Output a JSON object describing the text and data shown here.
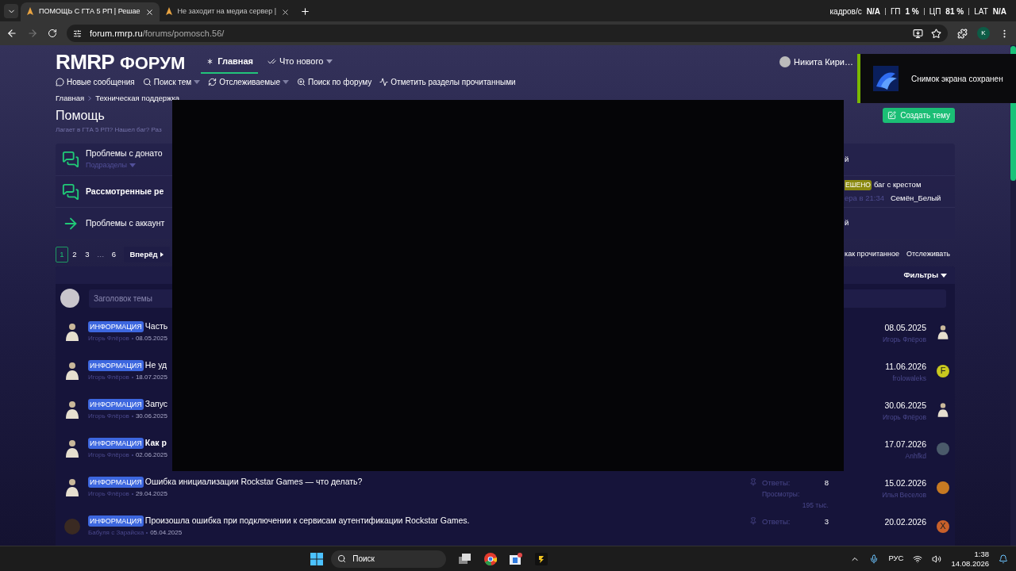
{
  "browser": {
    "tabs": [
      {
        "title": "ПОМОЩЬ С ГТА 5 РП | Решае",
        "selected": true
      },
      {
        "title": "Не заходит на медиа сервер |",
        "selected": false
      }
    ],
    "url_host": "forum.rmrp.ru",
    "url_path": "/forums/pomosch.56/",
    "profile_initial": "K"
  },
  "perf_overlay": [
    {
      "label": "кадров/с",
      "value": "N/A"
    },
    {
      "label": "ГП",
      "value": "1 %"
    },
    {
      "label": "ЦП",
      "value": "81 %"
    },
    {
      "label": "LAT",
      "value": "N/A"
    }
  ],
  "header": {
    "logo": "RMRP",
    "logo_word": "ФОРУМ",
    "nav": [
      {
        "label": "Главная",
        "selected": true,
        "has_menu": false
      },
      {
        "label": "Что нового",
        "selected": false,
        "has_menu": true
      }
    ],
    "user": "Никита Кири…"
  },
  "subnav": [
    {
      "label": "Новые сообщения",
      "kind": "chat",
      "has_menu": false
    },
    {
      "label": "Поиск тем",
      "kind": "search",
      "has_menu": true
    },
    {
      "label": "Отслеживаемые",
      "kind": "refresh",
      "has_menu": true
    },
    {
      "label": "Поиск по форуму",
      "kind": "zoom",
      "has_menu": false
    },
    {
      "label": "Отметить разделы прочитанными",
      "kind": "wave",
      "has_menu": false
    }
  ],
  "toast": {
    "text": "Снимок экрана сохранен"
  },
  "breadcrumbs": [
    "Главная",
    "Техническая поддержка"
  ],
  "title": "Помощь",
  "description": "Лагает в ГТА 5 РП? Нашел баг? Раз",
  "create_button": "Создать тему",
  "nodes": [
    {
      "kind": "chat",
      "title": "Проблемы с донато",
      "unread": false,
      "sub": "Подразделы",
      "right": "й"
    },
    {
      "kind": "chat",
      "title": "Рассмотренные ре",
      "unread": true,
      "last": {
        "prefix": "ЕШЕНО",
        "title": "баг с крестом",
        "date": "ера в 21:34",
        "user": "Семён_Белый"
      }
    },
    {
      "kind": "redirect",
      "title": "Проблемы с аккаунт",
      "unread": false,
      "right": "й"
    }
  ],
  "pagination": {
    "pages": [
      {
        "kind": "page",
        "label": "1",
        "selected": true
      },
      {
        "kind": "page",
        "label": "2",
        "selected": false
      },
      {
        "kind": "page",
        "label": "3",
        "selected": false
      },
      {
        "kind": "gap",
        "label": "…",
        "selected": false
      },
      {
        "kind": "page",
        "label": "6",
        "selected": false
      }
    ],
    "next": "Вперёд"
  },
  "actions": [
    "как прочитанное",
    "Отслеживать"
  ],
  "filters": "Фильтры",
  "quick_thread": {
    "placeholder": "Заголовок темы"
  },
  "threads": [
    {
      "avatar": {
        "kind": "figure"
      },
      "prefix": "ИНФОРМАЦИЯ",
      "title": "Часть",
      "unread": false,
      "author": "Игорь Флёров",
      "date": "08.05.2025",
      "last_date": "08.05.2025",
      "last_user": "Игорь Флёров",
      "last_avatar": {
        "kind": "figure"
      }
    },
    {
      "avatar": {
        "kind": "figure"
      },
      "prefix": "ИНФОРМАЦИЯ",
      "title": "Не уд",
      "unread": false,
      "author": "Игорь Флёров",
      "date": "18.07.2025",
      "last_date": "11.06.2026",
      "last_user": "frolowaleks",
      "last_avatar": {
        "kind": "letter",
        "initial": "F",
        "color": "#c8c81e"
      }
    },
    {
      "avatar": {
        "kind": "figure"
      },
      "prefix": "ИНФОРМАЦИЯ",
      "title": "Запус",
      "unread": false,
      "author": "Игорь Флёров",
      "date": "30.06.2025",
      "last_date": "30.06.2025",
      "last_user": "Игорь Флёров",
      "last_avatar": {
        "kind": "figure"
      }
    },
    {
      "avatar": {
        "kind": "figure"
      },
      "prefix": "ИНФОРМАЦИЯ",
      "title": "Как р",
      "unread": true,
      "author": "Игорь Флёров",
      "date": "02.06.2025",
      "last_date": "17.07.2026",
      "last_user": "Anhfkd"
    },
    {
      "avatar": {
        "kind": "figure"
      },
      "prefix": "ИНФОРМАЦИЯ",
      "title": "Ошибка инициализации Rockstar Games — что делать?",
      "unread": false,
      "author": "Игорь Флёров",
      "date": "29.04.2025",
      "stats": {
        "replies_label": "Ответы:",
        "replies": "8",
        "views_label": "Просмотры:",
        "views": "195 тыс."
      },
      "last_date": "15.02.2026",
      "last_user": "Илья Веселов"
    },
    {
      "prefix": "ИНФОРМАЦИЯ",
      "title": "Произошла ошибка при подключении к сервисам аутентификации Rockstar Games.",
      "unread": false,
      "author": "Бабуля с Зарайска",
      "date": "05.04.2025",
      "stats": {
        "replies_label": "Ответы:",
        "replies": "3"
      },
      "last_date": "20.02.2026",
      "last_avatar": {
        "kind": "letter",
        "initial": "X",
        "color": "#c8602a"
      }
    }
  ],
  "taskbar": {
    "search": "Поиск",
    "lang": "РУС",
    "time": "1:38",
    "date": "14.08.2026"
  }
}
